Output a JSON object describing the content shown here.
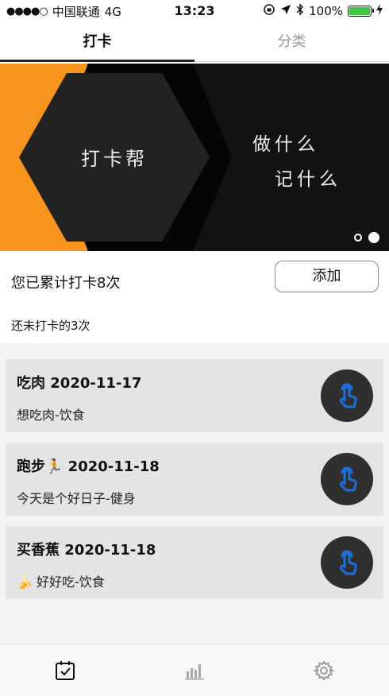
{
  "status_bar": {
    "signal_dots": "●●●●○",
    "carrier": "中国联通",
    "network": "4G",
    "time": "13:23",
    "battery": "100%",
    "battery_color": "#3fc83f"
  },
  "tabs": [
    {
      "label": "打卡",
      "active": true
    },
    {
      "label": "分类",
      "active": false
    }
  ],
  "banner": {
    "title": "打卡帮",
    "line1": "做什么",
    "line2": "记什么",
    "active_slide": 2,
    "slide_count": 2
  },
  "summary": {
    "total": "您已累计打卡8次",
    "add_label": "添加",
    "pending": "还未打卡的3次"
  },
  "cards": [
    {
      "title": "吃肉  2020-11-17",
      "subtitle": "想吃肉-饮食"
    },
    {
      "title": "跑步🏃  2020-11-18",
      "subtitle": "今天是个好日子-健身"
    },
    {
      "title": "买香蕉  2020-11-18",
      "subtitle": "🍌 好好吃-饮食"
    }
  ],
  "colors": {
    "accent_orange": "#f7941d",
    "banner_dark": "#121212",
    "punch_icon_blue": "#1e6fd9"
  },
  "tab_bar": [
    {
      "icon": "calendar-check-icon",
      "active": true
    },
    {
      "icon": "bar-chart-icon",
      "active": false
    },
    {
      "icon": "gear-icon",
      "active": false
    }
  ]
}
